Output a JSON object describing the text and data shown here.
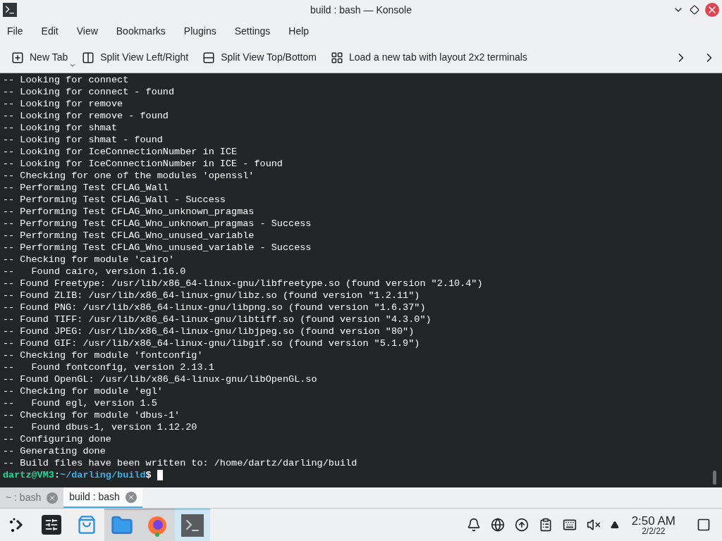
{
  "window": {
    "title": "build : bash — Konsole"
  },
  "menu": [
    "File",
    "Edit",
    "View",
    "Bookmarks",
    "Plugins",
    "Settings",
    "Help"
  ],
  "toolbar": [
    {
      "label": "New Tab",
      "kind": "new-tab"
    },
    {
      "label": "Split View Left/Right",
      "kind": "split-lr"
    },
    {
      "label": "Split View Top/Bottom",
      "kind": "split-tb"
    },
    {
      "label": "Load a new tab with layout 2x2 terminals",
      "kind": "layout"
    }
  ],
  "terminal": {
    "lines": [
      "-- Looking for connect",
      "-- Looking for connect - found",
      "-- Looking for remove",
      "-- Looking for remove - found",
      "-- Looking for shmat",
      "-- Looking for shmat - found",
      "-- Looking for IceConnectionNumber in ICE",
      "-- Looking for IceConnectionNumber in ICE - found",
      "-- Checking for one of the modules 'openssl'",
      "-- Performing Test CFLAG_Wall",
      "-- Performing Test CFLAG_Wall - Success",
      "-- Performing Test CFLAG_Wno_unknown_pragmas",
      "-- Performing Test CFLAG_Wno_unknown_pragmas - Success",
      "-- Performing Test CFLAG_Wno_unused_variable",
      "-- Performing Test CFLAG_Wno_unused_variable - Success",
      "-- Checking for module 'cairo'",
      "--   Found cairo, version 1.16.0",
      "-- Found Freetype: /usr/lib/x86_64-linux-gnu/libfreetype.so (found version \"2.10.4\")",
      "-- Found ZLIB: /usr/lib/x86_64-linux-gnu/libz.so (found version \"1.2.11\")",
      "-- Found PNG: /usr/lib/x86_64-linux-gnu/libpng.so (found version \"1.6.37\")",
      "-- Found TIFF: /usr/lib/x86_64-linux-gnu/libtiff.so (found version \"4.3.0\")",
      "-- Found JPEG: /usr/lib/x86_64-linux-gnu/libjpeg.so (found version \"80\")",
      "-- Found GIF: /usr/lib/x86_64-linux-gnu/libgif.so (found version \"5.1.9\")",
      "-- Checking for module 'fontconfig'",
      "--   Found fontconfig, version 2.13.1",
      "-- Found OpenGL: /usr/lib/x86_64-linux-gnu/libOpenGL.so",
      "-- Checking for module 'egl'",
      "--   Found egl, version 1.5",
      "-- Checking for module 'dbus-1'",
      "--   Found dbus-1, version 1.12.20",
      "-- Configuring done",
      "-- Generating done",
      "-- Build files have been written to: /home/dartz/darling/build"
    ],
    "prompt": {
      "user_host": "dartz@VM3",
      "separator": ":",
      "path": "~/darling/build",
      "symbol": "$"
    }
  },
  "tabs": [
    {
      "label": "~ : bash",
      "selected": false
    },
    {
      "label": "build : bash",
      "selected": true
    }
  ],
  "taskbar": {
    "apps": [
      {
        "kind": "settings",
        "open": false,
        "active": false
      },
      {
        "kind": "discover",
        "open": false,
        "active": false
      },
      {
        "kind": "files",
        "open": true,
        "active": false
      },
      {
        "kind": "browser",
        "open": true,
        "active": false
      },
      {
        "kind": "terminal",
        "open": true,
        "active": true
      }
    ],
    "clock": {
      "time": "2:50 AM",
      "date": "2/2/22"
    }
  }
}
